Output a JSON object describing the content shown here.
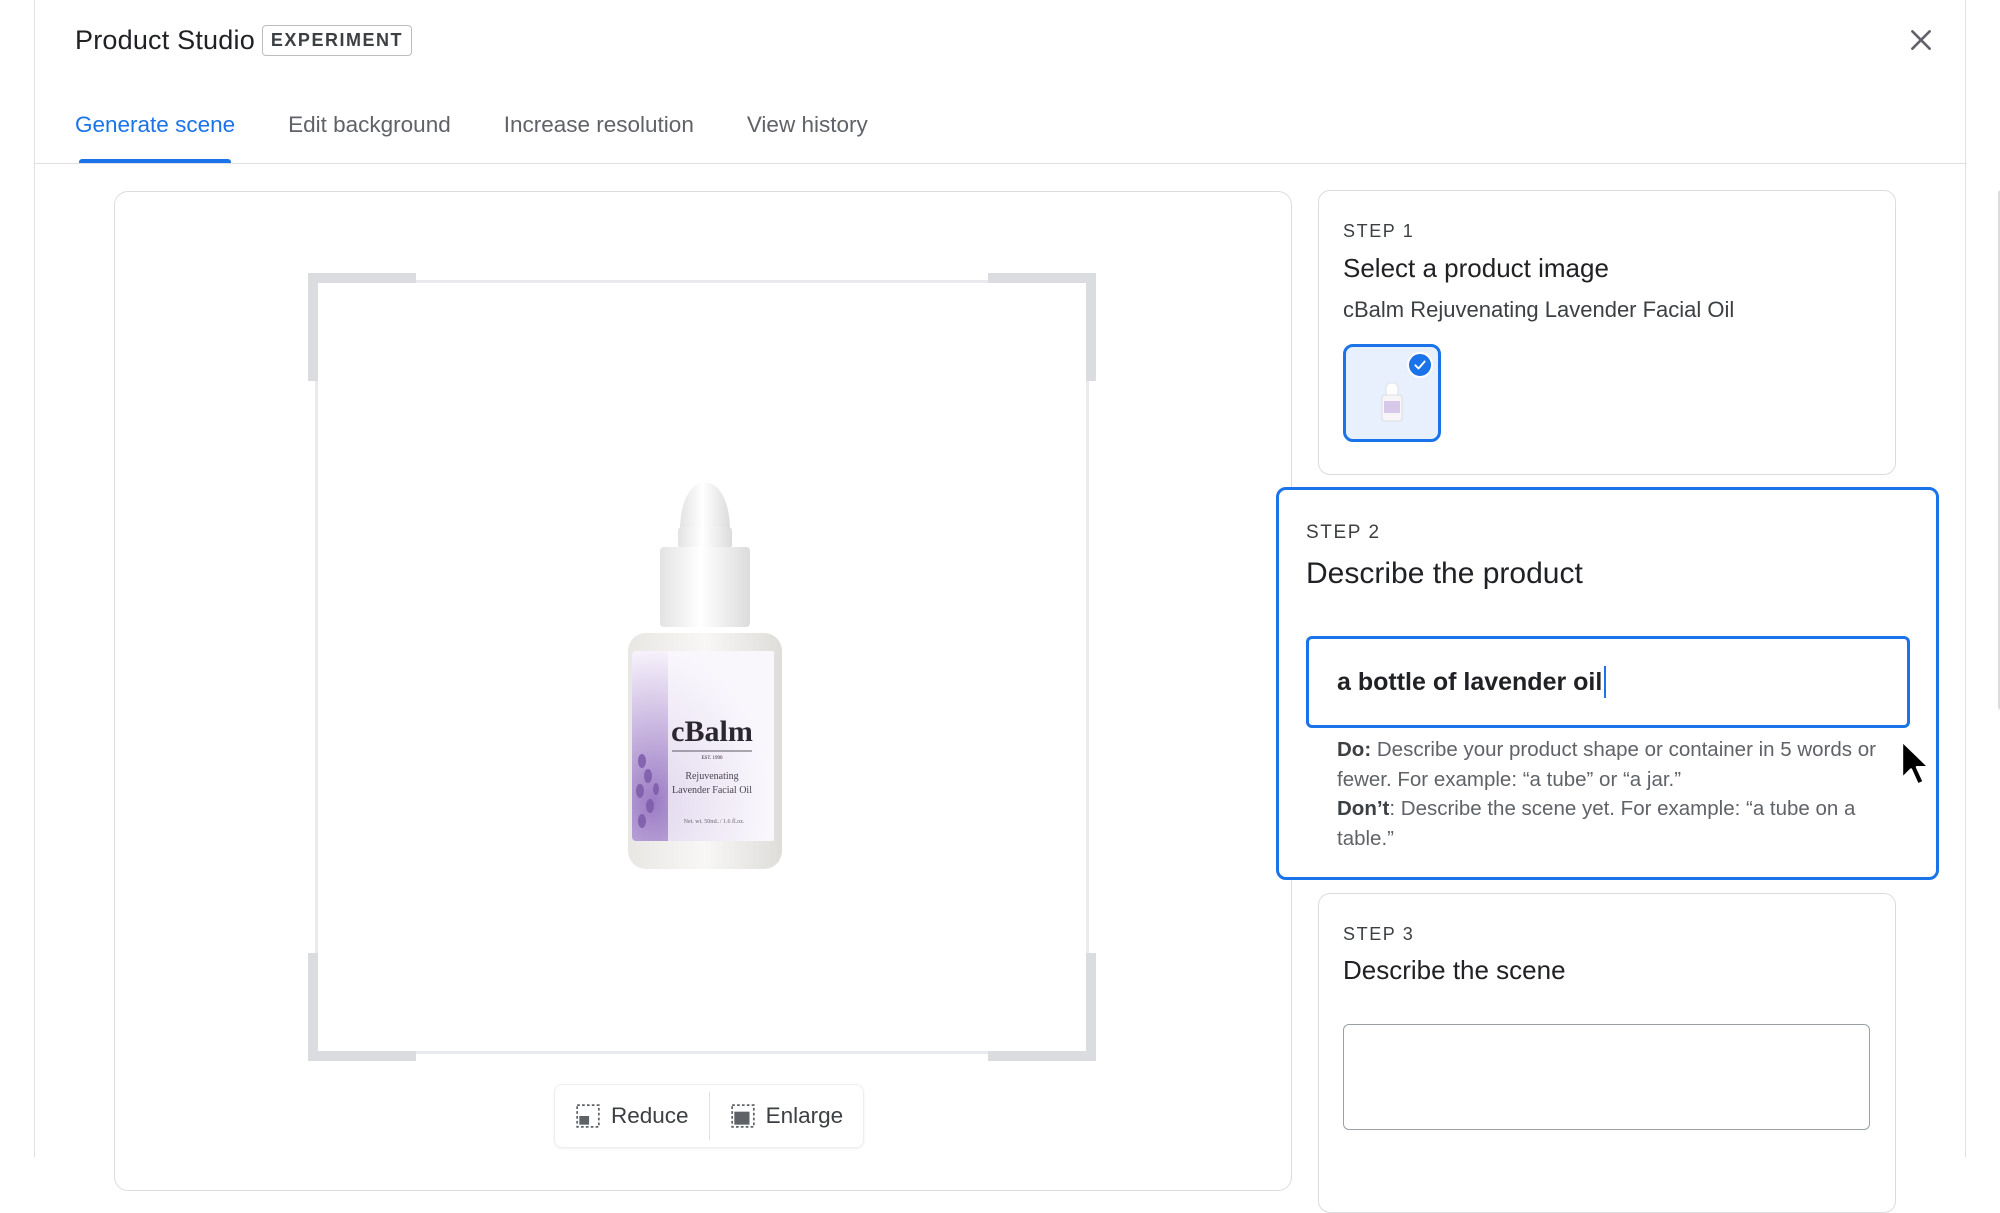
{
  "app": {
    "title": "Product Studio",
    "badge": "EXPERIMENT",
    "close_icon": "close-icon"
  },
  "tabs": [
    {
      "label": "Generate scene",
      "active": true
    },
    {
      "label": "Edit background",
      "active": false
    },
    {
      "label": "Increase resolution",
      "active": false
    },
    {
      "label": "View history",
      "active": false
    }
  ],
  "preview": {
    "product_label": {
      "brand": "cBalm",
      "est": "EST. 1990",
      "name_line1": "Rejuvenating",
      "name_line2": "Lavender Facial Oil",
      "net_wt": "Net. wt. 50mL / 1.6 fl.oz."
    },
    "zoom": {
      "reduce_label": "Reduce",
      "enlarge_label": "Enlarge"
    }
  },
  "steps": {
    "step1": {
      "label": "STEP 1",
      "title": "Select a product image",
      "product_name": "cBalm Rejuvenating Lavender Facial Oil",
      "thumbnail_selected": true
    },
    "step2": {
      "label": "STEP 2",
      "title": "Describe the product",
      "input_value": "a bottle of lavender oil",
      "help_do_label": "Do:",
      "help_do_text": "Describe your product shape or container in 5 words or fewer. For example: “a tube” or “a jar.”",
      "help_dont_label": "Don’t",
      "help_dont_text": ": Describe the scene yet. For example: “a tube on a table.”"
    },
    "step3": {
      "label": "STEP 3",
      "title": "Describe the scene",
      "input_value": ""
    }
  },
  "colors": {
    "accent": "#1a73e8",
    "border": "#dadce0",
    "text": "#202124"
  }
}
